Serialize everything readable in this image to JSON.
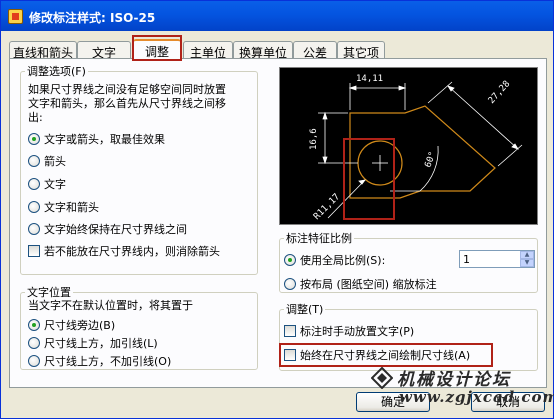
{
  "window": {
    "title": "修改标注样式: ISO-25"
  },
  "tabs": [
    {
      "label": "直线和箭头"
    },
    {
      "label": "文字"
    },
    {
      "label": "调整"
    },
    {
      "label": "主单位"
    },
    {
      "label": "换算单位"
    },
    {
      "label": "公差"
    },
    {
      "label": "其它项"
    }
  ],
  "fit_options": {
    "legend": "调整选项(F)",
    "description": [
      "如果尺寸界线之间没有足够空间同时放置",
      "文字和箭头，那么首先从尺寸界线之间移",
      "出:"
    ],
    "options": [
      {
        "label": "文字或箭头，取最佳效果",
        "selected": true
      },
      {
        "label": "箭头",
        "selected": false
      },
      {
        "label": "文字",
        "selected": false
      },
      {
        "label": "文字和箭头",
        "selected": false
      },
      {
        "label": "文字始终保持在尺寸界线之间",
        "selected": false
      }
    ],
    "suppress_checkbox": {
      "label": "若不能放在尺寸界线内，则消除箭头",
      "checked": false
    }
  },
  "text_placement": {
    "legend": "文字位置",
    "description": "当文字不在默认位置时，将其置于",
    "options": [
      {
        "label": "尺寸线旁边(B)",
        "selected": true
      },
      {
        "label": "尺寸线上方，加引线(L)",
        "selected": false
      },
      {
        "label": "尺寸线上方，不加引线(O)",
        "selected": false
      }
    ]
  },
  "preview": {
    "dims": {
      "top": "14,11",
      "left": "16,6",
      "right": "27,28",
      "angle": "60°",
      "radius": "R11,17"
    }
  },
  "scale": {
    "legend": "标注特征比例",
    "use_overall": {
      "label": "使用全局比例(S):",
      "selected": true
    },
    "overall_value": "1",
    "to_layout": {
      "label": "按布局 (图纸空间) 缩放标注",
      "selected": false
    }
  },
  "fine_tuning": {
    "legend": "调整(T)",
    "place_manually": {
      "label": "标注时手动放置文字(P)",
      "checked": false
    },
    "draw_between": {
      "label": "始终在尺寸界线之间绘制尺寸线(A)",
      "checked": false
    }
  },
  "buttons": {
    "ok": "确定",
    "cancel": "取消"
  },
  "watermark": {
    "cn": "机械设计论坛",
    "url": "www.zgjxcad.com"
  },
  "colors": {
    "titlebar": "#0454e0",
    "highlight": "#b02218",
    "preview_bg": "#000000",
    "preview_geometry": "#d08a1a"
  }
}
